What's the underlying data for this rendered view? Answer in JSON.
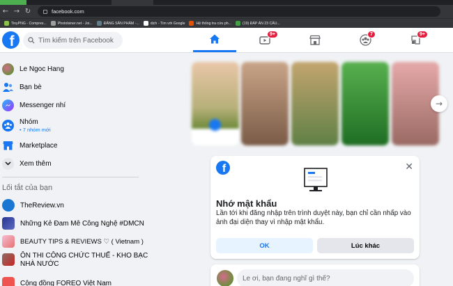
{
  "browser": {
    "url": "facebook.com",
    "bookmarks": [
      {
        "label": "TinyPNG - Compres...",
        "color": "#8bc34a"
      },
      {
        "label": "Photolsiner.net - Joi...",
        "color": "#9e9e9e"
      },
      {
        "label": "ĐĂNG SẢN PHẨM -...",
        "color": "#607d8b"
      },
      {
        "label": "dịch - Tìm với Google",
        "color": "#ffffff"
      },
      {
        "label": "Hệ thống tra cứu ph...",
        "color": "#e65100"
      },
      {
        "label": "(19) ĐÁP ÁN 23 CÂU...",
        "color": "#43a047"
      }
    ]
  },
  "header": {
    "logo": "f",
    "search_placeholder": "Tìm kiếm trên Facebook",
    "nav": [
      {
        "icon": "home-icon",
        "active": true,
        "badge": ""
      },
      {
        "icon": "watch-icon",
        "active": false,
        "badge": "9+"
      },
      {
        "icon": "marketplace-icon",
        "active": false,
        "badge": ""
      },
      {
        "icon": "groups-icon",
        "active": false,
        "badge": "7"
      },
      {
        "icon": "gaming-icon",
        "active": false,
        "badge": "9+"
      }
    ]
  },
  "sidebar": {
    "profile_name": "Le Ngoc Hang",
    "items": [
      {
        "label": "Bạn bè",
        "icon": "friends-icon"
      },
      {
        "label": "Messenger nhí",
        "icon": "messenger-kids-icon"
      },
      {
        "label": "Nhóm",
        "icon": "groups-icon",
        "sub": "• 7 nhóm mới"
      },
      {
        "label": "Marketplace",
        "icon": "marketplace-icon"
      },
      {
        "label": "Xem thêm",
        "icon": "chevron-down-icon"
      }
    ],
    "shortcuts_title": "Lối tắt của bạn",
    "shortcuts": [
      {
        "label": "TheReview.vn",
        "color": "#1976d2"
      },
      {
        "label": "Những Kẻ Đam Mê Công Nghệ #DMCN",
        "color": "#283593"
      },
      {
        "label": "BEAUTY TIPS & REVIEWS ♡ ( Vietnam )",
        "color": "#f8bbd0"
      },
      {
        "label_line1": "ÔN THI CÔNG CHỨC THUẾ - KHO BẠC",
        "label_line2": "NHÀ NƯỚC",
        "color": "#8d6e63"
      },
      {
        "label": "Cộng đồng FOREO Việt Nam",
        "color": "#ef5350"
      }
    ]
  },
  "stories": {
    "colors": [
      [
        "#e9c7a8",
        "#6e8a3a"
      ],
      [
        "#c9a487",
        "#7a5b47"
      ],
      [
        "#c3a56f",
        "#5f8045"
      ],
      [
        "#58b04e",
        "#1f6e24"
      ],
      [
        "#e5a9a9",
        "#9a6a63"
      ]
    ]
  },
  "save_login": {
    "title": "Nhớ mật khẩu",
    "description": "Lần tới khi đăng nhập trên trình duyệt này, bạn chỉ cần nhấp vào ảnh đại diện thay vì nhập mật khẩu.",
    "ok_label": "OK",
    "later_label": "Lúc khác"
  },
  "composer": {
    "placeholder": "Le ơi, bạn đang nghĩ gì thế?"
  }
}
